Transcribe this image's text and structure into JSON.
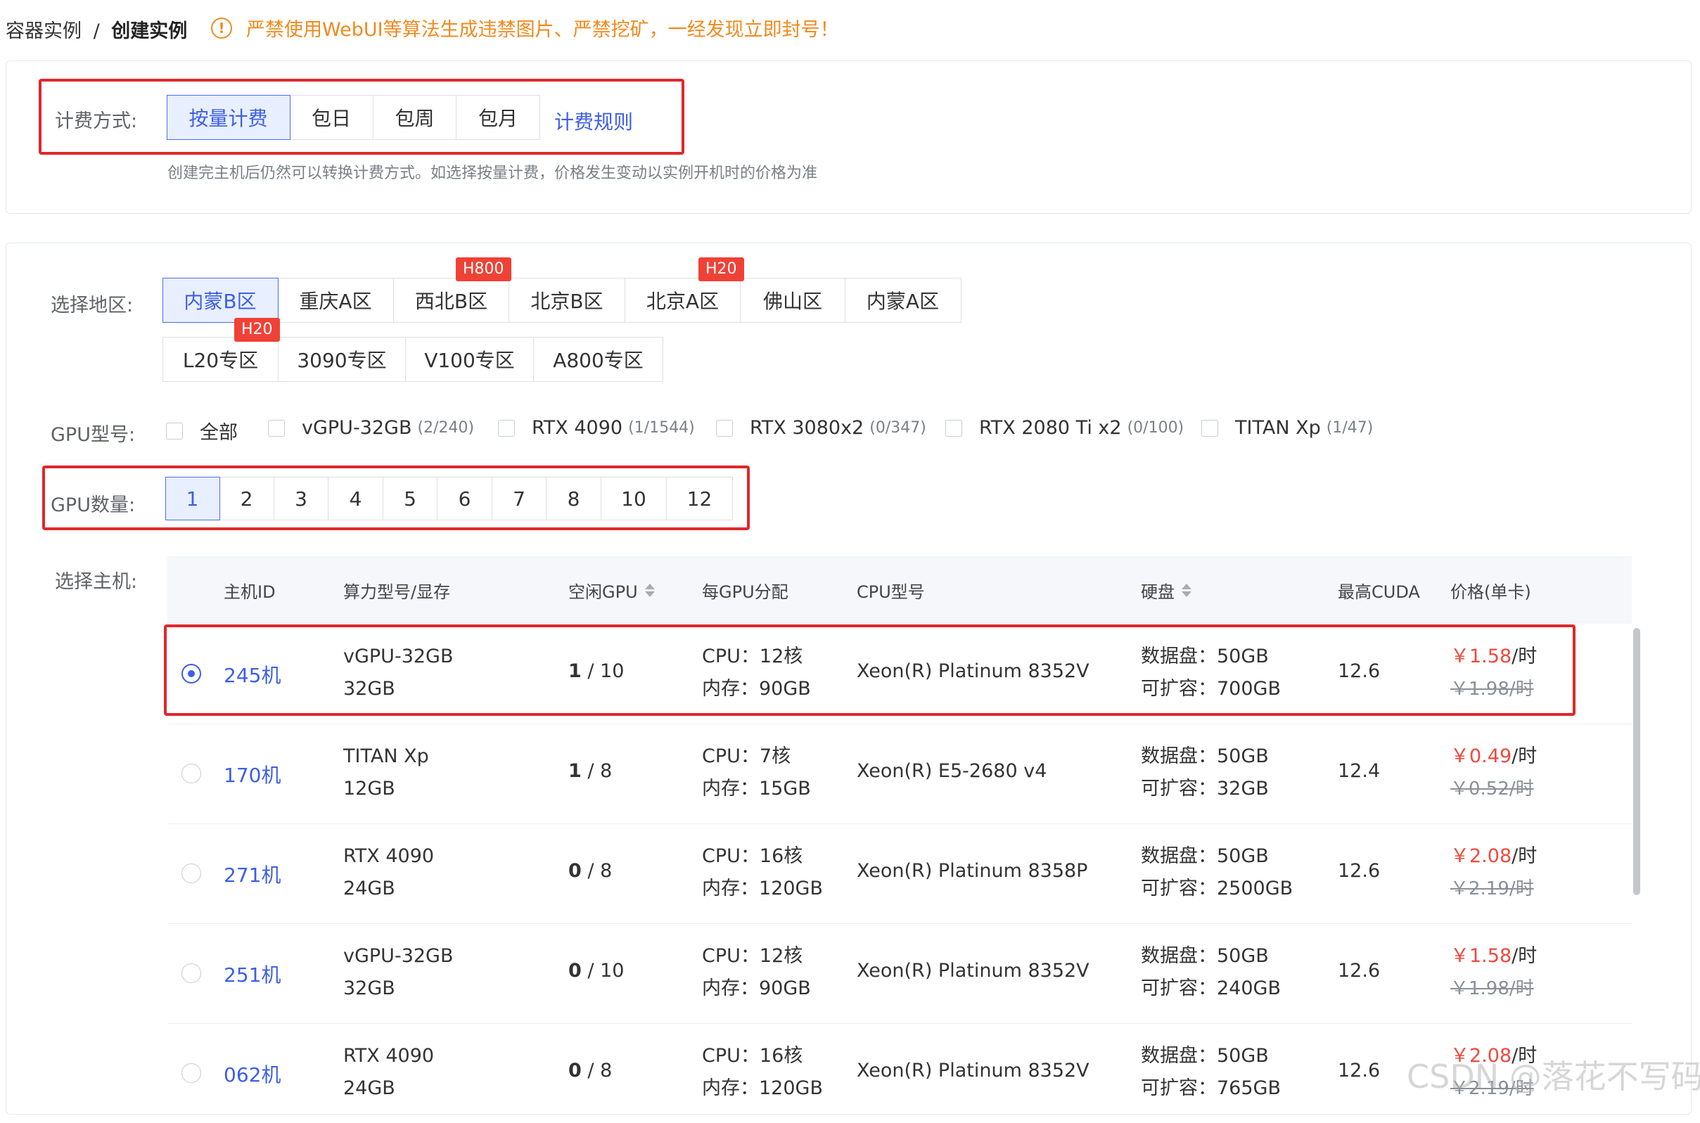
{
  "breadcrumb": {
    "parent": "容器实例",
    "sep": "/",
    "current": "创建实例"
  },
  "warning": {
    "icon": "exclamation-circle-icon",
    "text": "严禁使用WebUI等算法生成违禁图片、严禁挖矿，一经发现立即封号！"
  },
  "billing": {
    "label": "计费方式:",
    "options": [
      "按量计费",
      "包日",
      "包周",
      "包月"
    ],
    "selected": "按量计费",
    "rule_link": "计费规则",
    "hint": "创建完主机后仍然可以转换计费方式。如选择按量计费，价格发生变动以实例开机时的价格为准"
  },
  "region": {
    "label": "选择地区:",
    "row1": [
      {
        "name": "内蒙B区",
        "badge": ""
      },
      {
        "name": "重庆A区",
        "badge": ""
      },
      {
        "name": "西北B区",
        "badge": "H800"
      },
      {
        "name": "北京B区",
        "badge": ""
      },
      {
        "name": "北京A区",
        "badge": "H20"
      },
      {
        "name": "佛山区",
        "badge": ""
      },
      {
        "name": "内蒙A区",
        "badge": ""
      }
    ],
    "row2": [
      {
        "name": "L20专区",
        "badge": "H20"
      },
      {
        "name": "3090专区",
        "badge": ""
      },
      {
        "name": "V100专区",
        "badge": ""
      },
      {
        "name": "A800专区",
        "badge": ""
      }
    ],
    "selected": "内蒙B区"
  },
  "gpu_model": {
    "label": "GPU型号:",
    "options": [
      {
        "name": "全部",
        "count": ""
      },
      {
        "name": "vGPU-32GB",
        "count": "(2/240)"
      },
      {
        "name": "RTX 4090",
        "count": "(1/1544)"
      },
      {
        "name": "RTX 3080x2",
        "count": "(0/347)"
      },
      {
        "name": "RTX 2080 Ti x2",
        "count": "(0/100)"
      },
      {
        "name": "TITAN Xp",
        "count": "(1/47)"
      }
    ]
  },
  "gpu_count": {
    "label": "GPU数量:",
    "options": [
      "1",
      "2",
      "3",
      "4",
      "5",
      "6",
      "7",
      "8",
      "10",
      "12"
    ],
    "selected": "1"
  },
  "hosts": {
    "label": "选择主机:",
    "columns": [
      "主机ID",
      "算力型号/显存",
      "空闲GPU",
      "每GPU分配",
      "CPU型号",
      "硬盘",
      "最高CUDA",
      "价格(单卡)"
    ],
    "rows": [
      {
        "id": "245机",
        "model": "vGPU-32GB",
        "vram": "32GB",
        "free": "1",
        "total": "/ 10",
        "cpu": "CPU：12核",
        "mem": "内存：90GB",
        "cpu_model": "Xeon(R) Platinum 8352V",
        "disk": "数据盘：50GB",
        "expand": "可扩容：700GB",
        "cuda": "12.6",
        "price": "￥1.58",
        "unit": "/时",
        "old_price": "￥1.98/时",
        "selected": true
      },
      {
        "id": "170机",
        "model": "TITAN Xp",
        "vram": "12GB",
        "free": "1",
        "total": "/ 8",
        "cpu": "CPU：7核",
        "mem": "内存：15GB",
        "cpu_model": "Xeon(R) E5-2680 v4",
        "disk": "数据盘：50GB",
        "expand": "可扩容：32GB",
        "cuda": "12.4",
        "price": "￥0.49",
        "unit": "/时",
        "old_price": "￥0.52/时",
        "selected": false
      },
      {
        "id": "271机",
        "model": "RTX 4090",
        "vram": "24GB",
        "free": "0",
        "total": "/ 8",
        "cpu": "CPU：16核",
        "mem": "内存：120GB",
        "cpu_model": "Xeon(R) Platinum 8358P",
        "disk": "数据盘：50GB",
        "expand": "可扩容：2500GB",
        "cuda": "12.6",
        "price": "￥2.08",
        "unit": "/时",
        "old_price": "￥2.19/时",
        "selected": false
      },
      {
        "id": "251机",
        "model": "vGPU-32GB",
        "vram": "32GB",
        "free": "0",
        "total": "/ 10",
        "cpu": "CPU：12核",
        "mem": "内存：90GB",
        "cpu_model": "Xeon(R) Platinum 8352V",
        "disk": "数据盘：50GB",
        "expand": "可扩容：240GB",
        "cuda": "12.6",
        "price": "￥1.58",
        "unit": "/时",
        "old_price": "￥1.98/时",
        "selected": false
      },
      {
        "id": "062机",
        "model": "RTX 4090",
        "vram": "24GB",
        "free": "0",
        "total": "/ 8",
        "cpu": "CPU：16核",
        "mem": "内存：120GB",
        "cpu_model": "Xeon(R) Platinum 8352V",
        "disk": "数据盘：50GB",
        "expand": "可扩容：765GB",
        "cuda": "12.6",
        "price": "￥2.08",
        "unit": "/时",
        "old_price": "￥2.19/时",
        "selected": false
      }
    ]
  },
  "watermark": "CSDN @落花不写码",
  "colors": {
    "accent": "#3d5ee6",
    "warning": "#f08a1e",
    "price": "#f0493e",
    "highlight_box": "#e0272b",
    "badge": "#f04136"
  }
}
